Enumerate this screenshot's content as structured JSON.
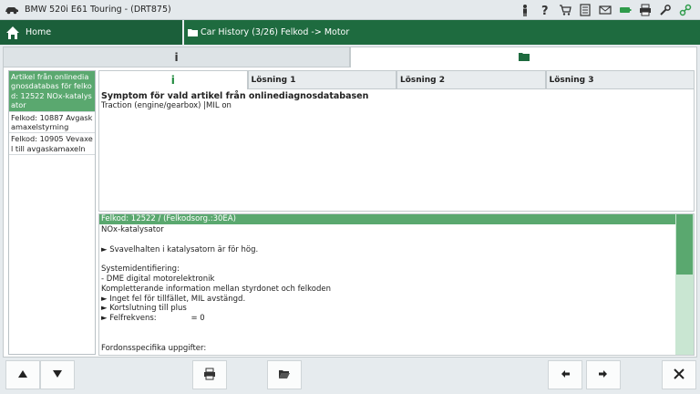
{
  "window": {
    "title": "BMW 520i E61 Touring - (DRT875)"
  },
  "system_icons": [
    "person-icon",
    "help-icon",
    "cart-icon",
    "mail-icon",
    "email-icon",
    "battery-icon",
    "printer-icon",
    "wrench-icon",
    "connection-icon"
  ],
  "nav": {
    "home_label": "Home",
    "breadcrumb": "Car History (3/26) Felkod -> Motor"
  },
  "main_tabs": {
    "info_label": "i"
  },
  "left_list": [
    {
      "text": "Artikel från onlinediagnosdatabas för felkod: 12522 NOx-katalysator"
    },
    {
      "text": "Felkod: 10887 Avgaskamaxelstyrning"
    },
    {
      "text": "Felkod: 10905 Vevaxel till avgaskamaxeln"
    }
  ],
  "sub_tabs": {
    "info_label": "i",
    "solution1": "Lösning 1",
    "solution2": "Lösning 2",
    "solution3": "Lösning 3"
  },
  "symptom": {
    "heading": "Symptom för vald artikel från onlinediagnosdatabasen",
    "text": "Traction (engine/gearbox) |MIL on"
  },
  "details": {
    "header": "Felkod: 12522 / (Felkodsorg.:30EA)",
    "lines": [
      "NOx-katalysator",
      "",
      "► Svavelhalten i katalysatorn är för hög.",
      "",
      "Systemidentifiering:",
      "- DME digital motorelektronik",
      "Kompletterande information mellan styrdonet och felkoden",
      "► Inget fel för tillfället, MIL avstängd.",
      "► Kortslutning till plus",
      "► Felfrekvens:              = 0",
      "",
      "",
      "Fordonsspecifika uppgifter:"
    ]
  },
  "colors": {
    "dark_green": "#1b5f3a",
    "selection_green": "#5aa86f",
    "scroll_track": "#c9e6d2"
  }
}
